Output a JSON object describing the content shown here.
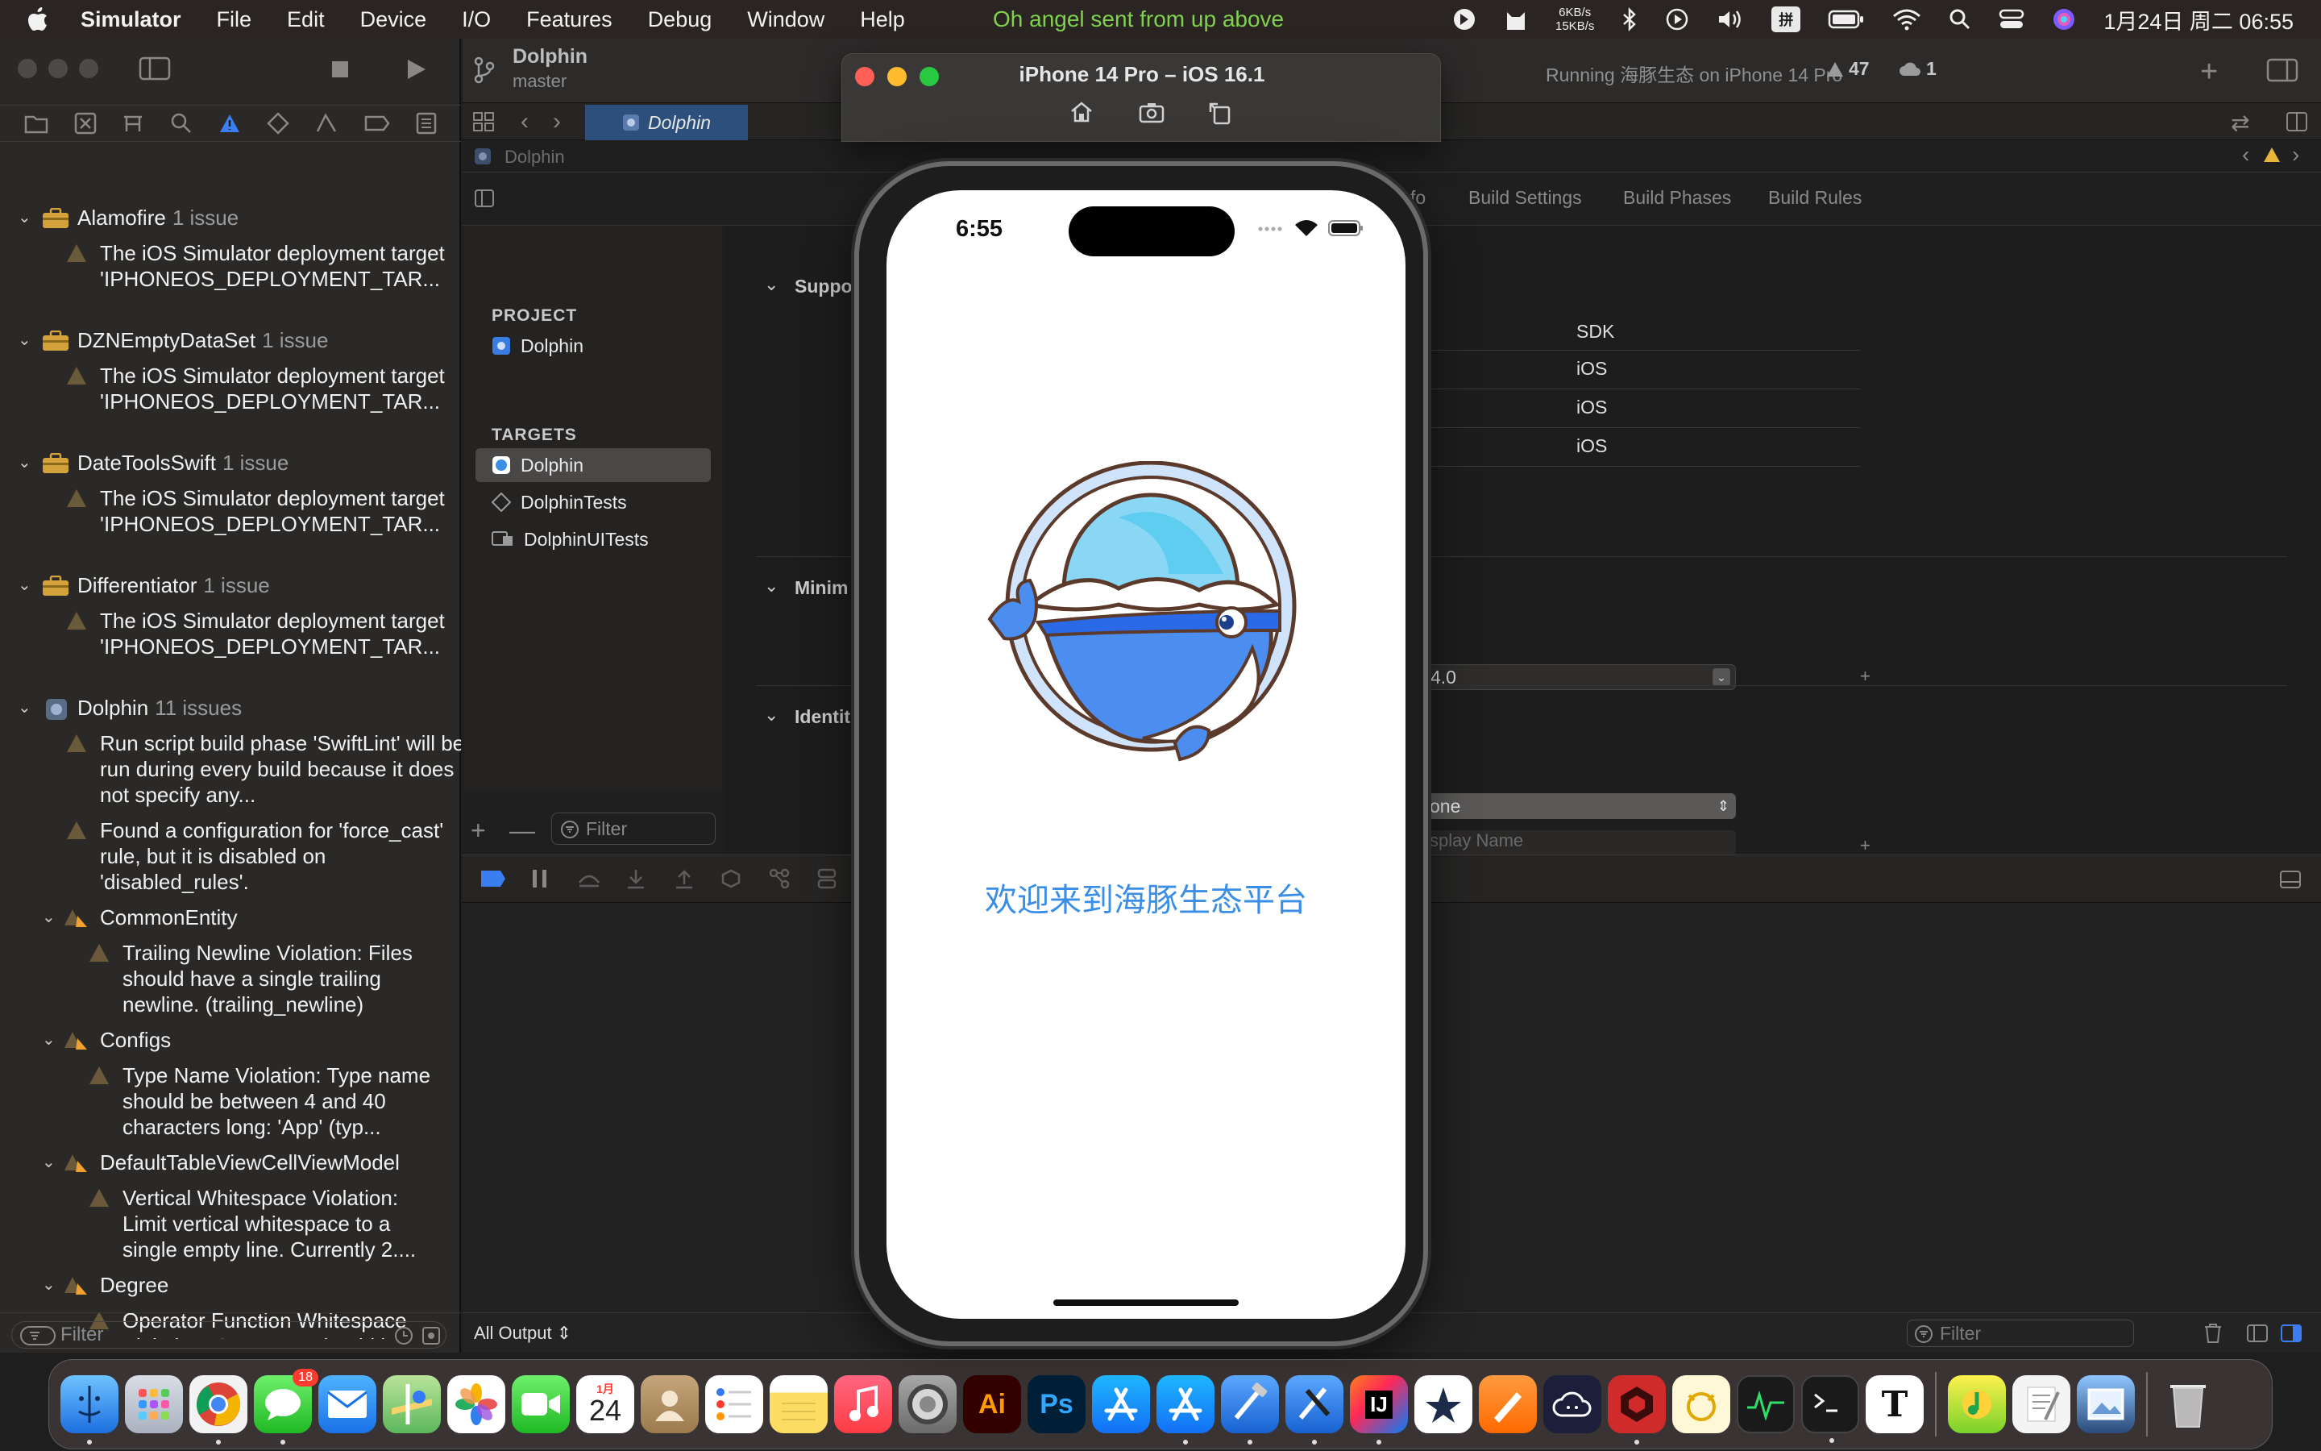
{
  "menubar": {
    "app_name": "Simulator",
    "items": [
      "File",
      "Edit",
      "Device",
      "I/O",
      "Features",
      "Debug",
      "Window",
      "Help"
    ],
    "now_playing": "Oh angel sent from up above",
    "net_up": "6KB/s",
    "net_down": "15KB/s",
    "ime": "拼",
    "clock": "1月24日 周二  06:55"
  },
  "toolbar": {
    "project_name": "Dolphin",
    "branch": "master",
    "status": "Running 海豚生态 on iPhone 14 Pro",
    "warnings": "47",
    "errors": "1"
  },
  "tabbar": {
    "active_tab": "Dolphin"
  },
  "jumpbar": {
    "label": "Dolphin"
  },
  "editor_tabs": [
    "fo",
    "Build Settings",
    "Build Phases",
    "Build Rules"
  ],
  "project_list": {
    "project_header": "PROJECT",
    "project_item": "Dolphin",
    "targets_header": "TARGETS",
    "targets": [
      "Dolphin",
      "DolphinTests",
      "DolphinUITests"
    ],
    "filter_placeholder": "Filter"
  },
  "settings": {
    "section_support": "Suppo",
    "sdk_header": "SDK",
    "sdk_values": [
      "iOS",
      "iOS",
      "iOS"
    ],
    "section_minimum": "Minim",
    "min_version": "4.0",
    "section_identity": "Identit",
    "identity_value": "one",
    "display_name_placeholder": "splay Name"
  },
  "issues": {
    "groups": [
      {
        "name": "Alamofire",
        "count": "1 issue",
        "messages": [
          "The iOS Simulator deployment target 'IPHONEOS_DEPLOYMENT_TAR..."
        ]
      },
      {
        "name": "DZNEmptyDataSet",
        "count": "1 issue",
        "messages": [
          "The iOS Simulator deployment target 'IPHONEOS_DEPLOYMENT_TAR..."
        ]
      },
      {
        "name": "DateToolsSwift",
        "count": "1 issue",
        "messages": [
          "The iOS Simulator deployment target 'IPHONEOS_DEPLOYMENT_TAR..."
        ]
      },
      {
        "name": "Differentiator",
        "count": "1 issue",
        "messages": [
          "The iOS Simulator deployment target 'IPHONEOS_DEPLOYMENT_TAR..."
        ]
      },
      {
        "name": "Dolphin",
        "count": "11 issues",
        "messages": [
          "Run script build phase 'SwiftLint' will be run during every build because it does not specify any...",
          "Found a configuration for 'force_cast' rule, but it is disabled on 'disabled_rules'."
        ]
      }
    ],
    "subgroups": [
      {
        "name": "CommonEntity",
        "message": "Trailing Newline Violation: Files should have a single trailing newline. (trailing_newline)"
      },
      {
        "name": "Configs",
        "message": "Type Name Violation: Type name should be between 4 and 40 characters long: 'App' (typ..."
      },
      {
        "name": "DefaultTableViewCellViewModel",
        "message": "Vertical Whitespace Violation: Limit vertical whitespace to a single empty line. Currently 2...."
      },
      {
        "name": "Degree",
        "message": "Operator Function Whitespace Violation: Operators should be"
      }
    ],
    "filter_placeholder": "Filter"
  },
  "console": {
    "output_selector": "All Output ⇕",
    "filter_placeholder": "Filter"
  },
  "simulator": {
    "title": "iPhone 14 Pro – iOS 16.1",
    "time": "6:55",
    "welcome_text": "欢迎来到海豚生态平台",
    "accent_color": "#3a8ee6"
  },
  "dock": {
    "calendar_month": "1月",
    "calendar_day": "24",
    "messages_badge": "18",
    "adobe_illustrator": "Ai",
    "adobe_photoshop": "Ps",
    "jetbrains": "IJ",
    "typora": "T"
  }
}
